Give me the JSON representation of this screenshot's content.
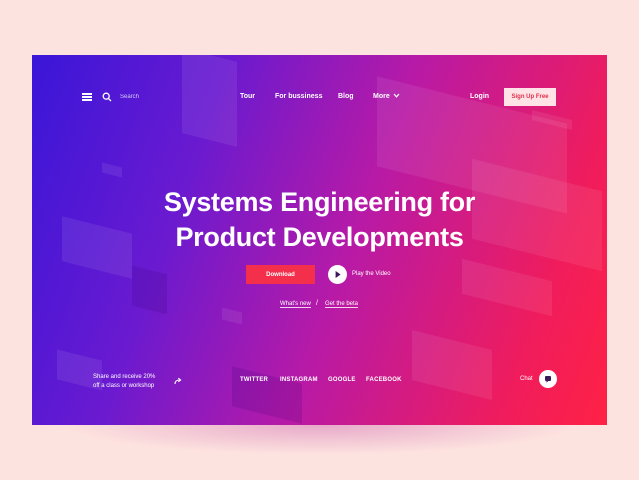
{
  "nav": {
    "search_placeholder": "Search",
    "links": [
      "Tour",
      "For bussiness",
      "Blog",
      "More"
    ],
    "login": "Login",
    "signup": "Sign Up Free"
  },
  "hero": {
    "headline_line1": "Systems Engineering for",
    "headline_line2": "Product Developments",
    "download": "Download",
    "play_video": "Play the Video",
    "whats_new": "What's new",
    "separator": "/",
    "get_beta": "Get the beta"
  },
  "footer": {
    "promo_line1": "Share and receive 20%",
    "promo_line2": "off a class or workshop",
    "social": [
      "TWITTER",
      "INSTAGRAM",
      "GOOGLE",
      "FACEBOOK"
    ],
    "chat": "Chat"
  },
  "colors": {
    "background": "#fde3df",
    "gradient_start": "#3a16d8",
    "gradient_end": "#ff2245",
    "download_button": "#f32f4c",
    "signup_button": "#ffe3e6"
  },
  "icons": [
    "hamburger-icon",
    "search-icon",
    "chevron-down-icon",
    "play-icon",
    "share-arrow-icon",
    "chat-icon"
  ]
}
